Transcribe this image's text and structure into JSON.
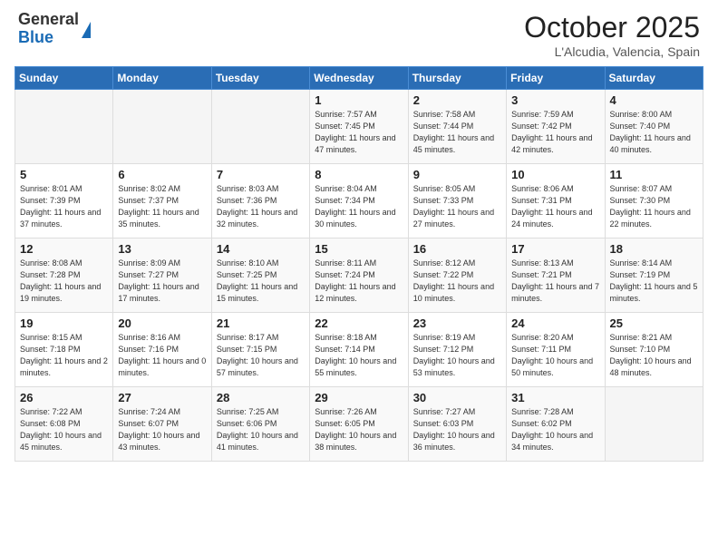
{
  "logo": {
    "general": "General",
    "blue": "Blue"
  },
  "header": {
    "month": "October 2025",
    "location": "L'Alcudia, Valencia, Spain"
  },
  "weekdays": [
    "Sunday",
    "Monday",
    "Tuesday",
    "Wednesday",
    "Thursday",
    "Friday",
    "Saturday"
  ],
  "weeks": [
    [
      {
        "day": "",
        "sunrise": "",
        "sunset": "",
        "daylight": ""
      },
      {
        "day": "",
        "sunrise": "",
        "sunset": "",
        "daylight": ""
      },
      {
        "day": "",
        "sunrise": "",
        "sunset": "",
        "daylight": ""
      },
      {
        "day": "1",
        "sunrise": "Sunrise: 7:57 AM",
        "sunset": "Sunset: 7:45 PM",
        "daylight": "Daylight: 11 hours and 47 minutes."
      },
      {
        "day": "2",
        "sunrise": "Sunrise: 7:58 AM",
        "sunset": "Sunset: 7:44 PM",
        "daylight": "Daylight: 11 hours and 45 minutes."
      },
      {
        "day": "3",
        "sunrise": "Sunrise: 7:59 AM",
        "sunset": "Sunset: 7:42 PM",
        "daylight": "Daylight: 11 hours and 42 minutes."
      },
      {
        "day": "4",
        "sunrise": "Sunrise: 8:00 AM",
        "sunset": "Sunset: 7:40 PM",
        "daylight": "Daylight: 11 hours and 40 minutes."
      }
    ],
    [
      {
        "day": "5",
        "sunrise": "Sunrise: 8:01 AM",
        "sunset": "Sunset: 7:39 PM",
        "daylight": "Daylight: 11 hours and 37 minutes."
      },
      {
        "day": "6",
        "sunrise": "Sunrise: 8:02 AM",
        "sunset": "Sunset: 7:37 PM",
        "daylight": "Daylight: 11 hours and 35 minutes."
      },
      {
        "day": "7",
        "sunrise": "Sunrise: 8:03 AM",
        "sunset": "Sunset: 7:36 PM",
        "daylight": "Daylight: 11 hours and 32 minutes."
      },
      {
        "day": "8",
        "sunrise": "Sunrise: 8:04 AM",
        "sunset": "Sunset: 7:34 PM",
        "daylight": "Daylight: 11 hours and 30 minutes."
      },
      {
        "day": "9",
        "sunrise": "Sunrise: 8:05 AM",
        "sunset": "Sunset: 7:33 PM",
        "daylight": "Daylight: 11 hours and 27 minutes."
      },
      {
        "day": "10",
        "sunrise": "Sunrise: 8:06 AM",
        "sunset": "Sunset: 7:31 PM",
        "daylight": "Daylight: 11 hours and 24 minutes."
      },
      {
        "day": "11",
        "sunrise": "Sunrise: 8:07 AM",
        "sunset": "Sunset: 7:30 PM",
        "daylight": "Daylight: 11 hours and 22 minutes."
      }
    ],
    [
      {
        "day": "12",
        "sunrise": "Sunrise: 8:08 AM",
        "sunset": "Sunset: 7:28 PM",
        "daylight": "Daylight: 11 hours and 19 minutes."
      },
      {
        "day": "13",
        "sunrise": "Sunrise: 8:09 AM",
        "sunset": "Sunset: 7:27 PM",
        "daylight": "Daylight: 11 hours and 17 minutes."
      },
      {
        "day": "14",
        "sunrise": "Sunrise: 8:10 AM",
        "sunset": "Sunset: 7:25 PM",
        "daylight": "Daylight: 11 hours and 15 minutes."
      },
      {
        "day": "15",
        "sunrise": "Sunrise: 8:11 AM",
        "sunset": "Sunset: 7:24 PM",
        "daylight": "Daylight: 11 hours and 12 minutes."
      },
      {
        "day": "16",
        "sunrise": "Sunrise: 8:12 AM",
        "sunset": "Sunset: 7:22 PM",
        "daylight": "Daylight: 11 hours and 10 minutes."
      },
      {
        "day": "17",
        "sunrise": "Sunrise: 8:13 AM",
        "sunset": "Sunset: 7:21 PM",
        "daylight": "Daylight: 11 hours and 7 minutes."
      },
      {
        "day": "18",
        "sunrise": "Sunrise: 8:14 AM",
        "sunset": "Sunset: 7:19 PM",
        "daylight": "Daylight: 11 hours and 5 minutes."
      }
    ],
    [
      {
        "day": "19",
        "sunrise": "Sunrise: 8:15 AM",
        "sunset": "Sunset: 7:18 PM",
        "daylight": "Daylight: 11 hours and 2 minutes."
      },
      {
        "day": "20",
        "sunrise": "Sunrise: 8:16 AM",
        "sunset": "Sunset: 7:16 PM",
        "daylight": "Daylight: 11 hours and 0 minutes."
      },
      {
        "day": "21",
        "sunrise": "Sunrise: 8:17 AM",
        "sunset": "Sunset: 7:15 PM",
        "daylight": "Daylight: 10 hours and 57 minutes."
      },
      {
        "day": "22",
        "sunrise": "Sunrise: 8:18 AM",
        "sunset": "Sunset: 7:14 PM",
        "daylight": "Daylight: 10 hours and 55 minutes."
      },
      {
        "day": "23",
        "sunrise": "Sunrise: 8:19 AM",
        "sunset": "Sunset: 7:12 PM",
        "daylight": "Daylight: 10 hours and 53 minutes."
      },
      {
        "day": "24",
        "sunrise": "Sunrise: 8:20 AM",
        "sunset": "Sunset: 7:11 PM",
        "daylight": "Daylight: 10 hours and 50 minutes."
      },
      {
        "day": "25",
        "sunrise": "Sunrise: 8:21 AM",
        "sunset": "Sunset: 7:10 PM",
        "daylight": "Daylight: 10 hours and 48 minutes."
      }
    ],
    [
      {
        "day": "26",
        "sunrise": "Sunrise: 7:22 AM",
        "sunset": "Sunset: 6:08 PM",
        "daylight": "Daylight: 10 hours and 45 minutes."
      },
      {
        "day": "27",
        "sunrise": "Sunrise: 7:24 AM",
        "sunset": "Sunset: 6:07 PM",
        "daylight": "Daylight: 10 hours and 43 minutes."
      },
      {
        "day": "28",
        "sunrise": "Sunrise: 7:25 AM",
        "sunset": "Sunset: 6:06 PM",
        "daylight": "Daylight: 10 hours and 41 minutes."
      },
      {
        "day": "29",
        "sunrise": "Sunrise: 7:26 AM",
        "sunset": "Sunset: 6:05 PM",
        "daylight": "Daylight: 10 hours and 38 minutes."
      },
      {
        "day": "30",
        "sunrise": "Sunrise: 7:27 AM",
        "sunset": "Sunset: 6:03 PM",
        "daylight": "Daylight: 10 hours and 36 minutes."
      },
      {
        "day": "31",
        "sunrise": "Sunrise: 7:28 AM",
        "sunset": "Sunset: 6:02 PM",
        "daylight": "Daylight: 10 hours and 34 minutes."
      },
      {
        "day": "",
        "sunrise": "",
        "sunset": "",
        "daylight": ""
      }
    ]
  ]
}
